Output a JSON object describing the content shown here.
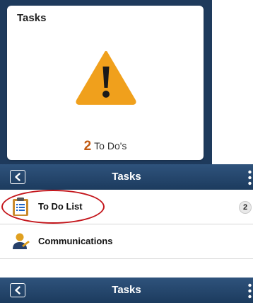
{
  "tile": {
    "title": "Tasks",
    "count": "2",
    "count_label": "To Do's",
    "icon": "warning-icon"
  },
  "navbar_top": {
    "title": "Tasks",
    "back_icon": "chevron-left-icon",
    "menu_icon": "kebab-icon"
  },
  "list": {
    "items": [
      {
        "label": "To Do List",
        "icon": "clipboard-list-icon",
        "badge": "2"
      },
      {
        "label": "Communications",
        "icon": "user-message-icon"
      }
    ]
  },
  "navbar_bottom": {
    "title": "Tasks",
    "back_icon": "chevron-left-icon",
    "menu_icon": "kebab-icon"
  },
  "colors": {
    "nav_background": "#1c3b5e",
    "tile_frame": "#1e3a5c",
    "warning": "#f0a01c",
    "count_accent": "#c15a12",
    "highlight": "#c4161c"
  }
}
